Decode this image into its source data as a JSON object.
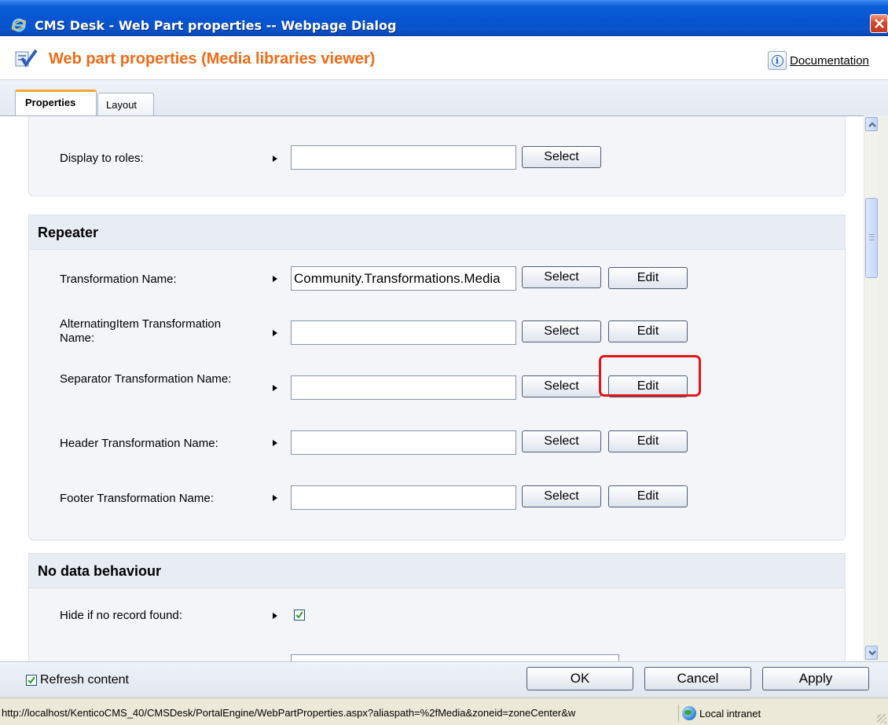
{
  "window": {
    "title": "CMS Desk - Web Part properties -- Webpage Dialog"
  },
  "header": {
    "title": "Web part properties (Media libraries viewer)",
    "documentation_label": "Documentation"
  },
  "tabs": [
    {
      "label": "Properties",
      "active": true
    },
    {
      "label": "Layout",
      "active": false
    }
  ],
  "visibility_panel": {
    "rows": [
      {
        "label": "Display to roles:",
        "value": "",
        "select_label": "Select"
      }
    ]
  },
  "repeater_panel": {
    "heading": "Repeater",
    "rows": [
      {
        "label": "Transformation Name:",
        "value": "Community.Transformations.Media",
        "select_label": "Select",
        "edit_label": "Edit"
      },
      {
        "label": "AlternatingItem Transformation Name:",
        "value": "",
        "select_label": "Select",
        "edit_label": "Edit"
      },
      {
        "label": "Separator Transformation Name:",
        "value": "",
        "select_label": "Select",
        "edit_label": "Edit"
      },
      {
        "label": "Header Transformation Name:",
        "value": "",
        "select_label": "Select",
        "edit_label": "Edit"
      },
      {
        "label": "Footer Transformation Name:",
        "value": "",
        "select_label": "Select",
        "edit_label": "Edit"
      }
    ]
  },
  "nodata_panel": {
    "heading": "No data behaviour",
    "rows": [
      {
        "label": "Hide if no record found:",
        "checked": true
      }
    ]
  },
  "footer": {
    "refresh_label": "Refresh content",
    "refresh_checked": true,
    "ok_label": "OK",
    "cancel_label": "Cancel",
    "apply_label": "Apply"
  },
  "statusbar": {
    "url": "http://localhost/KenticoCMS_40/CMSDesk/PortalEngine/WebPartProperties.aspx?aliaspath=%2fMedia&zoneid=zoneCenter&w",
    "zone": "Local intranet"
  },
  "colors": {
    "titlebar": "#0754d1",
    "header_title": "#ee6b17",
    "highlight": "#e3151a",
    "tab_accent": "#f7a535"
  }
}
